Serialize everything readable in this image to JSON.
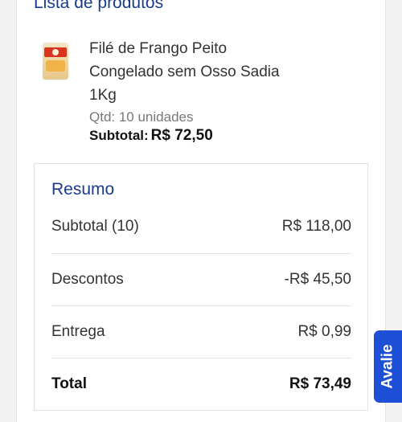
{
  "section": {
    "title": "Lista de produtos"
  },
  "product": {
    "image_icon": "sadia-package-icon",
    "name": "Filé de Frango Peito Congelado sem Osso Sadia 1Kg",
    "qty": "Qtd: 10 unidades",
    "subtotal_label": "Subtotal:",
    "subtotal_value": "R$ 72,50"
  },
  "summary": {
    "title": "Resumo",
    "rows": [
      {
        "label": "Subtotal (10)",
        "value": "R$ 118,00"
      },
      {
        "label": "Descontos",
        "value": "-R$ 45,50"
      },
      {
        "label": "Entrega",
        "value": "R$ 0,99"
      },
      {
        "label": "Total",
        "value": "R$ 73,49"
      }
    ]
  },
  "feedback": {
    "label": "Avalie",
    "color": "#1c4fd6"
  },
  "colors": {
    "accent": "#1a3b8a"
  }
}
